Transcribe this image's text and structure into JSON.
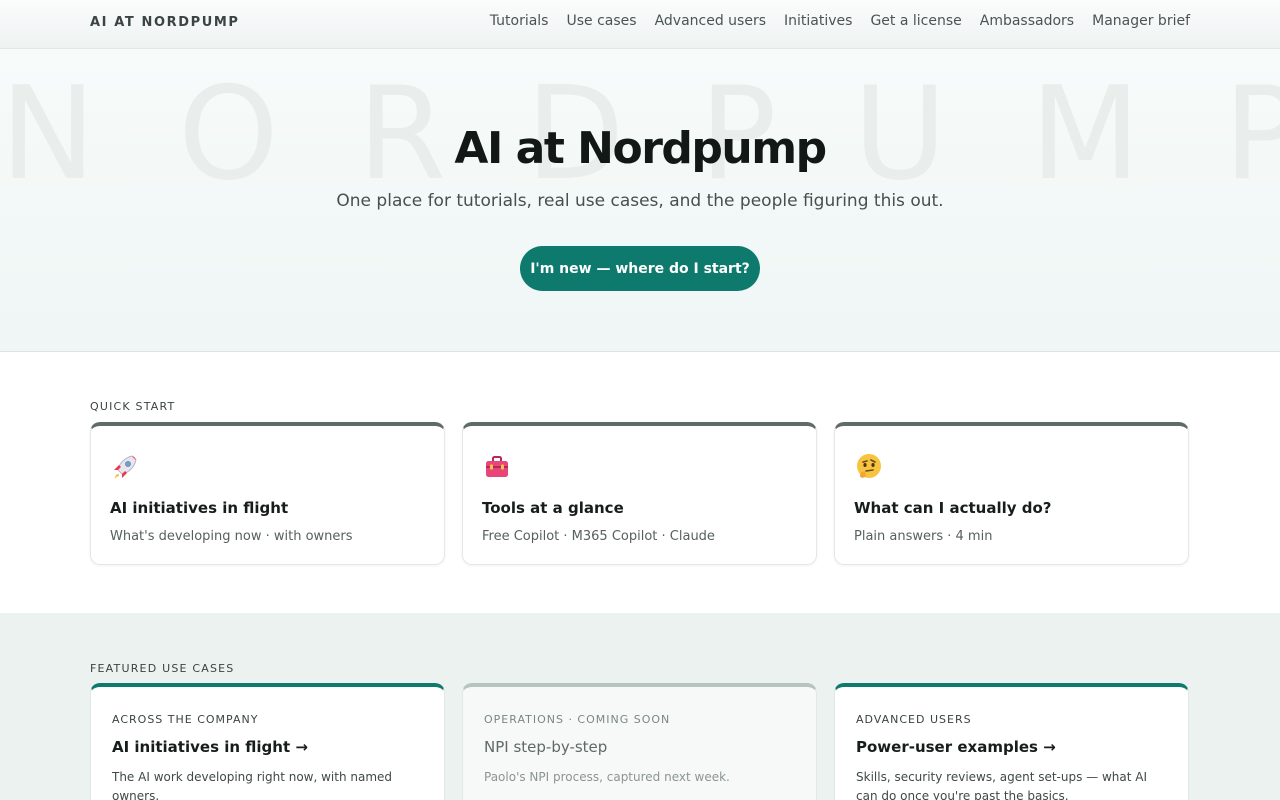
{
  "nav": {
    "brand": "AI AT NORDPUMP",
    "links": [
      "Tutorials",
      "Use cases",
      "Advanced users",
      "Initiatives",
      "Get a license",
      "Ambassadors",
      "Manager brief"
    ]
  },
  "hero": {
    "watermark": [
      "N",
      "O",
      "R",
      "D",
      "P",
      "U",
      "M",
      "P"
    ],
    "title": "AI at Nordpump",
    "subtitle": "One place for tutorials, real use cases, and the people figuring this out.",
    "cta_label": "I'm new — where do I start?"
  },
  "quick_start": {
    "label": "QUICK START",
    "cards": [
      {
        "icon": "rocket-icon",
        "title": "AI initiatives in flight",
        "meta": "What's developing now · with owners"
      },
      {
        "icon": "toolbox-icon",
        "title": "Tools at a glance",
        "meta": "Free Copilot · M365 Copilot · Claude"
      },
      {
        "icon": "thinking-face-icon",
        "title": "What can I actually do?",
        "meta": "Plain answers · 4 min"
      }
    ]
  },
  "featured": {
    "label": "FEATURED USE CASES",
    "cards": [
      {
        "kicker": "ACROSS THE COMPANY",
        "title": "AI initiatives in flight",
        "arrow": "→",
        "desc": "The AI work developing right now, with named owners."
      },
      {
        "kicker": "OPERATIONS · COMING SOON",
        "title": "NPI step-by-step",
        "arrow": "",
        "desc": "Paolo's NPI process, captured next week."
      },
      {
        "kicker": "ADVANCED USERS",
        "title": "Power-user examples",
        "arrow": "→",
        "desc": "Skills, security reviews, agent set-ups — what AI can do once you're past the basics."
      }
    ]
  },
  "colors": {
    "accent": "#0e7a6e",
    "quick_card_top": "#5f6b68",
    "soon_card_top": "#b8c2bf"
  }
}
